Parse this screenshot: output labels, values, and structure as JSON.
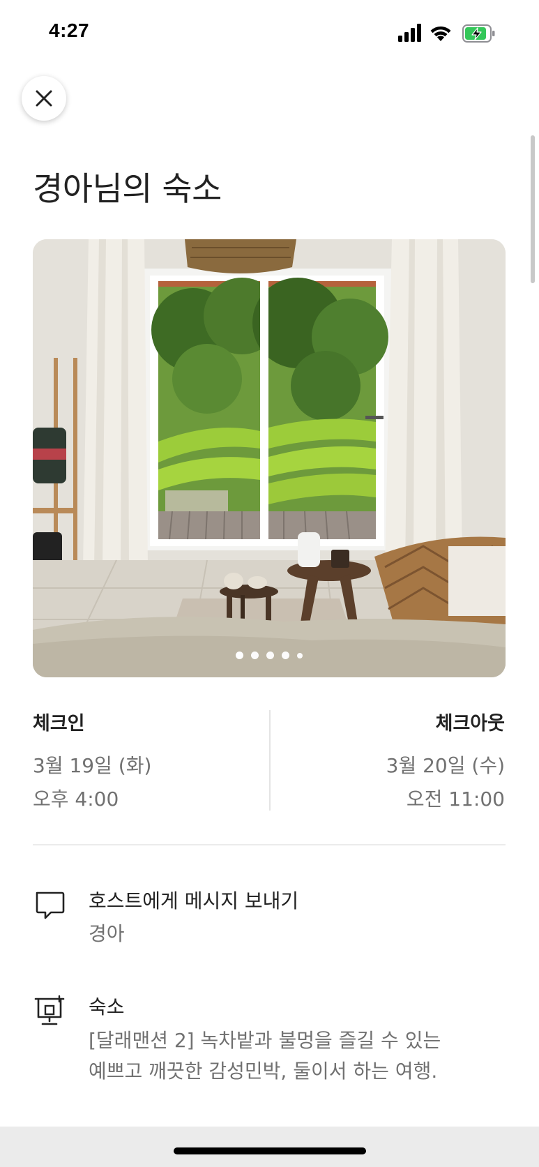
{
  "status_bar": {
    "time": "4:27",
    "icons": [
      "signal-icon",
      "wifi-icon",
      "battery-charging-icon"
    ],
    "battery_color": "#34c759"
  },
  "header": {
    "close_icon": "close-icon",
    "title": "경아님의 숙소"
  },
  "photo": {
    "description_icon": "listing-photo",
    "carousel_dots": 5,
    "active_dot": 0
  },
  "checkin": {
    "label": "체크인",
    "date": "3월 19일 (화)",
    "time": "오후 4:00"
  },
  "checkout": {
    "label": "체크아웃",
    "date": "3월 20일 (수)",
    "time": "오전 11:00"
  },
  "rows": [
    {
      "icon": "message-bubble-icon",
      "title": "호스트에게 메시지 보내기",
      "subtitle": "경아"
    },
    {
      "icon": "house-icon",
      "title": "숙소",
      "subtitle_lines": [
        "[달래맨션 2] 녹차밭과 불멍을 즐길 수 있는",
        "예쁘고 깨끗한 감성민박, 둘이서 하는 여행."
      ]
    }
  ],
  "colors": {
    "text_primary": "#222222",
    "text_secondary": "#717171",
    "divider": "#ebebeb"
  }
}
